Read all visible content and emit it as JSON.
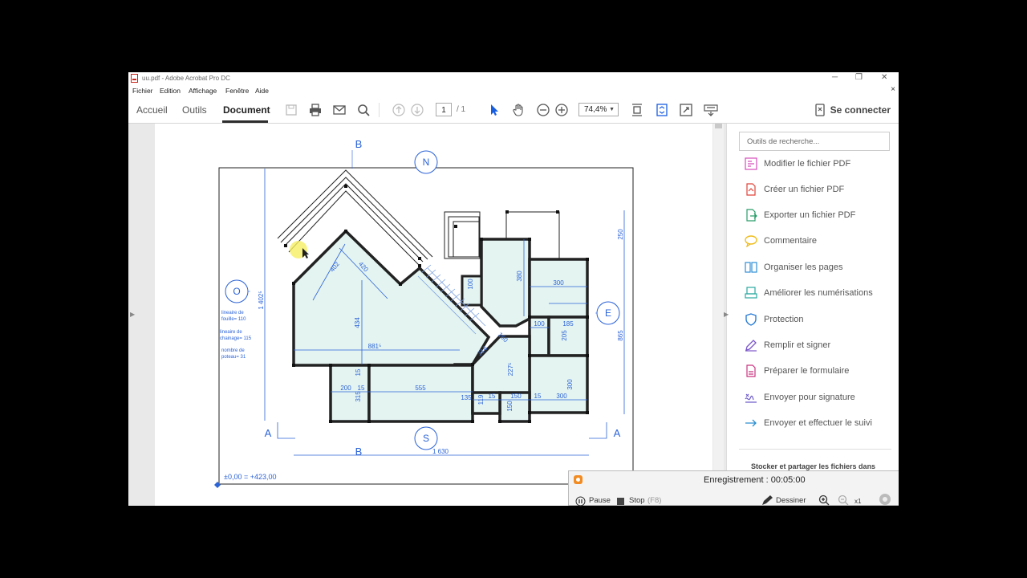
{
  "window": {
    "title": "uu.pdf - Adobe Acrobat Pro DC",
    "controls": {
      "minimize": "─",
      "restore": "❐",
      "close": "✕"
    },
    "close_doc": "×"
  },
  "menu": [
    "Fichier",
    "Edition",
    "Affichage",
    "Fenêtre",
    "Aide"
  ],
  "tabs": [
    "Accueil",
    "Outils",
    "Document"
  ],
  "toolbar": {
    "page_current": "1",
    "page_total": "/ 1",
    "zoom": "74,4%",
    "connect_label": "Se connecter",
    "icons": [
      "save-icon",
      "print-icon",
      "mail-icon",
      "search-icon",
      "prev-page-icon",
      "next-page-icon",
      "select-arrow-icon",
      "hand-icon",
      "zoom-out-icon",
      "zoom-in-icon",
      "fit-page-icon",
      "crop-icon",
      "fullscreen-icon",
      "keyboard-icon"
    ]
  },
  "plan": {
    "section_marks": {
      "top": "B",
      "bottom": "B",
      "left": "A",
      "right": "A"
    },
    "compass": {
      "north": "N",
      "south": "S",
      "west": "O",
      "east": "E"
    },
    "dims": {
      "total_width": "1 630",
      "total_height": "1 402⁵",
      "right_top": "250",
      "right_bottom": "865",
      "d402": "402",
      "d420": "420",
      "d434": "434",
      "d881": "881⁵",
      "d380": "380",
      "d300a": "300",
      "d100a": "100",
      "d100b": "100",
      "d185": "185",
      "d205": "205",
      "d300b": "300",
      "d300c": "300",
      "d555": "555",
      "d200": "200",
      "d15a": "15",
      "d15b": "15",
      "d15c": "15",
      "d15d": "15",
      "d315": "315",
      "d135": "135",
      "d119": "119",
      "d150a": "150",
      "d150b": "150",
      "d227": "227⁵",
      "d316": "316",
      "d160": "160"
    },
    "notes": [
      "lineaire de",
      "fouille= 110",
      "lineaire de",
      "chainage= 115",
      "nombre de",
      "poteau= 31"
    ],
    "elevation": "±0,00 = +423,00"
  },
  "right_panel": {
    "search_placeholder": "Outils de recherche...",
    "tools": [
      {
        "label": "Modifier le fichier PDF",
        "icon": "edit-pdf-icon",
        "color": "#d54dbb"
      },
      {
        "label": "Créer un fichier PDF",
        "icon": "create-pdf-icon",
        "color": "#e0443a"
      },
      {
        "label": "Exporter un fichier PDF",
        "icon": "export-pdf-icon",
        "color": "#2a9d6b"
      },
      {
        "label": "Commentaire",
        "icon": "comment-icon",
        "color": "#f0bd1c"
      },
      {
        "label": "Organiser les pages",
        "icon": "organize-pages-icon",
        "color": "#2d8ed6"
      },
      {
        "label": "Améliorer les numérisations",
        "icon": "scan-icon",
        "color": "#2aa8a0"
      },
      {
        "label": "Protection",
        "icon": "shield-icon",
        "color": "#2d7ed6"
      },
      {
        "label": "Remplir et signer",
        "icon": "fill-sign-icon",
        "color": "#7a55c9"
      },
      {
        "label": "Préparer le formulaire",
        "icon": "form-icon",
        "color": "#c9357f"
      },
      {
        "label": "Envoyer pour signature",
        "icon": "send-signature-icon",
        "color": "#6a56c8"
      },
      {
        "label": "Envoyer et effectuer le suivi",
        "icon": "send-track-icon",
        "color": "#2a8fd0"
      }
    ],
    "footer": "Stocker et partager les fichiers dans"
  },
  "recorder": {
    "title": "Enregistrement : 00:05:00",
    "pause_label": "Pause",
    "stop_label": "Stop",
    "stop_key": "(F8)",
    "draw_label": "Dessiner",
    "zoom_label": "x1"
  },
  "colors": {
    "room_fill": "#e4f4f1",
    "dimension": "#2b63d8",
    "accent_blue": "#1a5ee0"
  }
}
